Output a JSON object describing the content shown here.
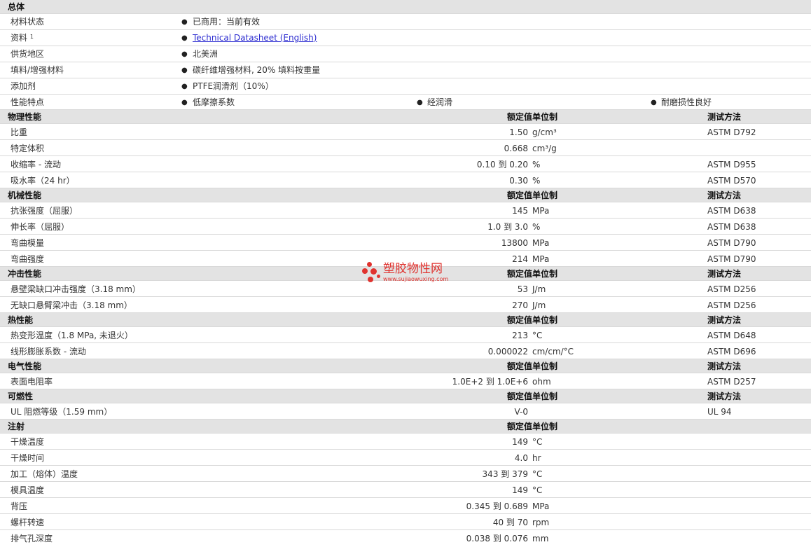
{
  "general": {
    "title": "总体",
    "rows": [
      {
        "label": "材料状态",
        "values": [
          "已商用：当前有效"
        ]
      },
      {
        "label": "资料",
        "sup": "1",
        "link": "Technical Datasheet (English)"
      },
      {
        "label": "供货地区",
        "values": [
          "北美洲"
        ]
      },
      {
        "label": "填料/增强材料",
        "values": [
          "碳纤维增强材料, 20% 填料按重量"
        ]
      },
      {
        "label": "添加剂",
        "values": [
          "PTFE润滑剂（10%）"
        ]
      },
      {
        "label": "性能特点",
        "values": [
          "低摩擦系数",
          "经润滑",
          "耐磨损性良好"
        ]
      }
    ]
  },
  "columns": {
    "nominal": "额定值",
    "unit": "单位制",
    "method": "测试方法"
  },
  "bullet": "●",
  "sections": [
    {
      "title": "物理性能",
      "show_method": true,
      "rows": [
        {
          "label": "比重",
          "value": "1.50",
          "unit": "g/cm³",
          "method": "ASTM D792"
        },
        {
          "label": "特定体积",
          "value": "0.668",
          "unit": "cm³/g",
          "method": ""
        },
        {
          "label": "收缩率  - 流动",
          "value": "0.10 到  0.20",
          "unit": "%",
          "method": "ASTM D955"
        },
        {
          "label": "吸水率（24 hr）",
          "value": "0.30",
          "unit": "%",
          "method": "ASTM D570"
        }
      ]
    },
    {
      "title": "机械性能",
      "show_method": true,
      "rows": [
        {
          "label": "抗张强度（屈服）",
          "value": "145",
          "unit": "MPa",
          "method": "ASTM D638"
        },
        {
          "label": "伸长率（屈服）",
          "value": "1.0 到  3.0",
          "unit": "%",
          "method": "ASTM D638"
        },
        {
          "label": "弯曲模量",
          "value": "13800",
          "unit": "MPa",
          "method": "ASTM D790"
        },
        {
          "label": "弯曲强度",
          "value": "214",
          "unit": "MPa",
          "method": "ASTM D790"
        }
      ]
    },
    {
      "title": "冲击性能",
      "show_method": true,
      "rows": [
        {
          "label": "悬壁梁缺口冲击强度（3.18 mm）",
          "value": "53",
          "unit": "J/m",
          "method": "ASTM D256"
        },
        {
          "label": "无缺口悬臂梁冲击（3.18 mm）",
          "value": "270",
          "unit": "J/m",
          "method": "ASTM D256"
        }
      ]
    },
    {
      "title": "热性能",
      "show_method": true,
      "rows": [
        {
          "label": "热变形温度（1.8 MPa, 未退火）",
          "value": "213",
          "unit": "°C",
          "method": "ASTM D648"
        },
        {
          "label": "线形膨胀系数  - 流动",
          "value": "0.000022",
          "unit": "cm/cm/°C",
          "method": "ASTM D696"
        }
      ]
    },
    {
      "title": "电气性能",
      "show_method": true,
      "rows": [
        {
          "label": "表面电阻率",
          "value": "1.0E+2 到  1.0E+6",
          "unit": "ohm",
          "method": "ASTM D257"
        }
      ]
    },
    {
      "title": "可燃性",
      "show_method": true,
      "rows": [
        {
          "label": "UL 阻燃等级（1.59 mm）",
          "value": "V-0",
          "unit": "",
          "method": "UL 94"
        }
      ]
    },
    {
      "title": "注射",
      "show_method": false,
      "rows": [
        {
          "label": "干燥温度",
          "value": "149",
          "unit": "°C",
          "method": ""
        },
        {
          "label": "干燥时间",
          "value": "4.0",
          "unit": "hr",
          "method": ""
        },
        {
          "label": "加工（熔体）温度",
          "value": "343 到  379",
          "unit": "°C",
          "method": ""
        },
        {
          "label": "模具温度",
          "value": "149",
          "unit": "°C",
          "method": ""
        },
        {
          "label": "背压",
          "value": "0.345 到  0.689",
          "unit": "MPa",
          "method": ""
        },
        {
          "label": "螺杆转速",
          "value": "40 到  70",
          "unit": "rpm",
          "method": ""
        },
        {
          "label": "排气孔深度",
          "value": "0.038 到  0.076",
          "unit": "mm",
          "method": ""
        }
      ]
    }
  ],
  "watermark": {
    "title": "塑胶物性网",
    "url": "www.sujiaowuxing.com"
  }
}
